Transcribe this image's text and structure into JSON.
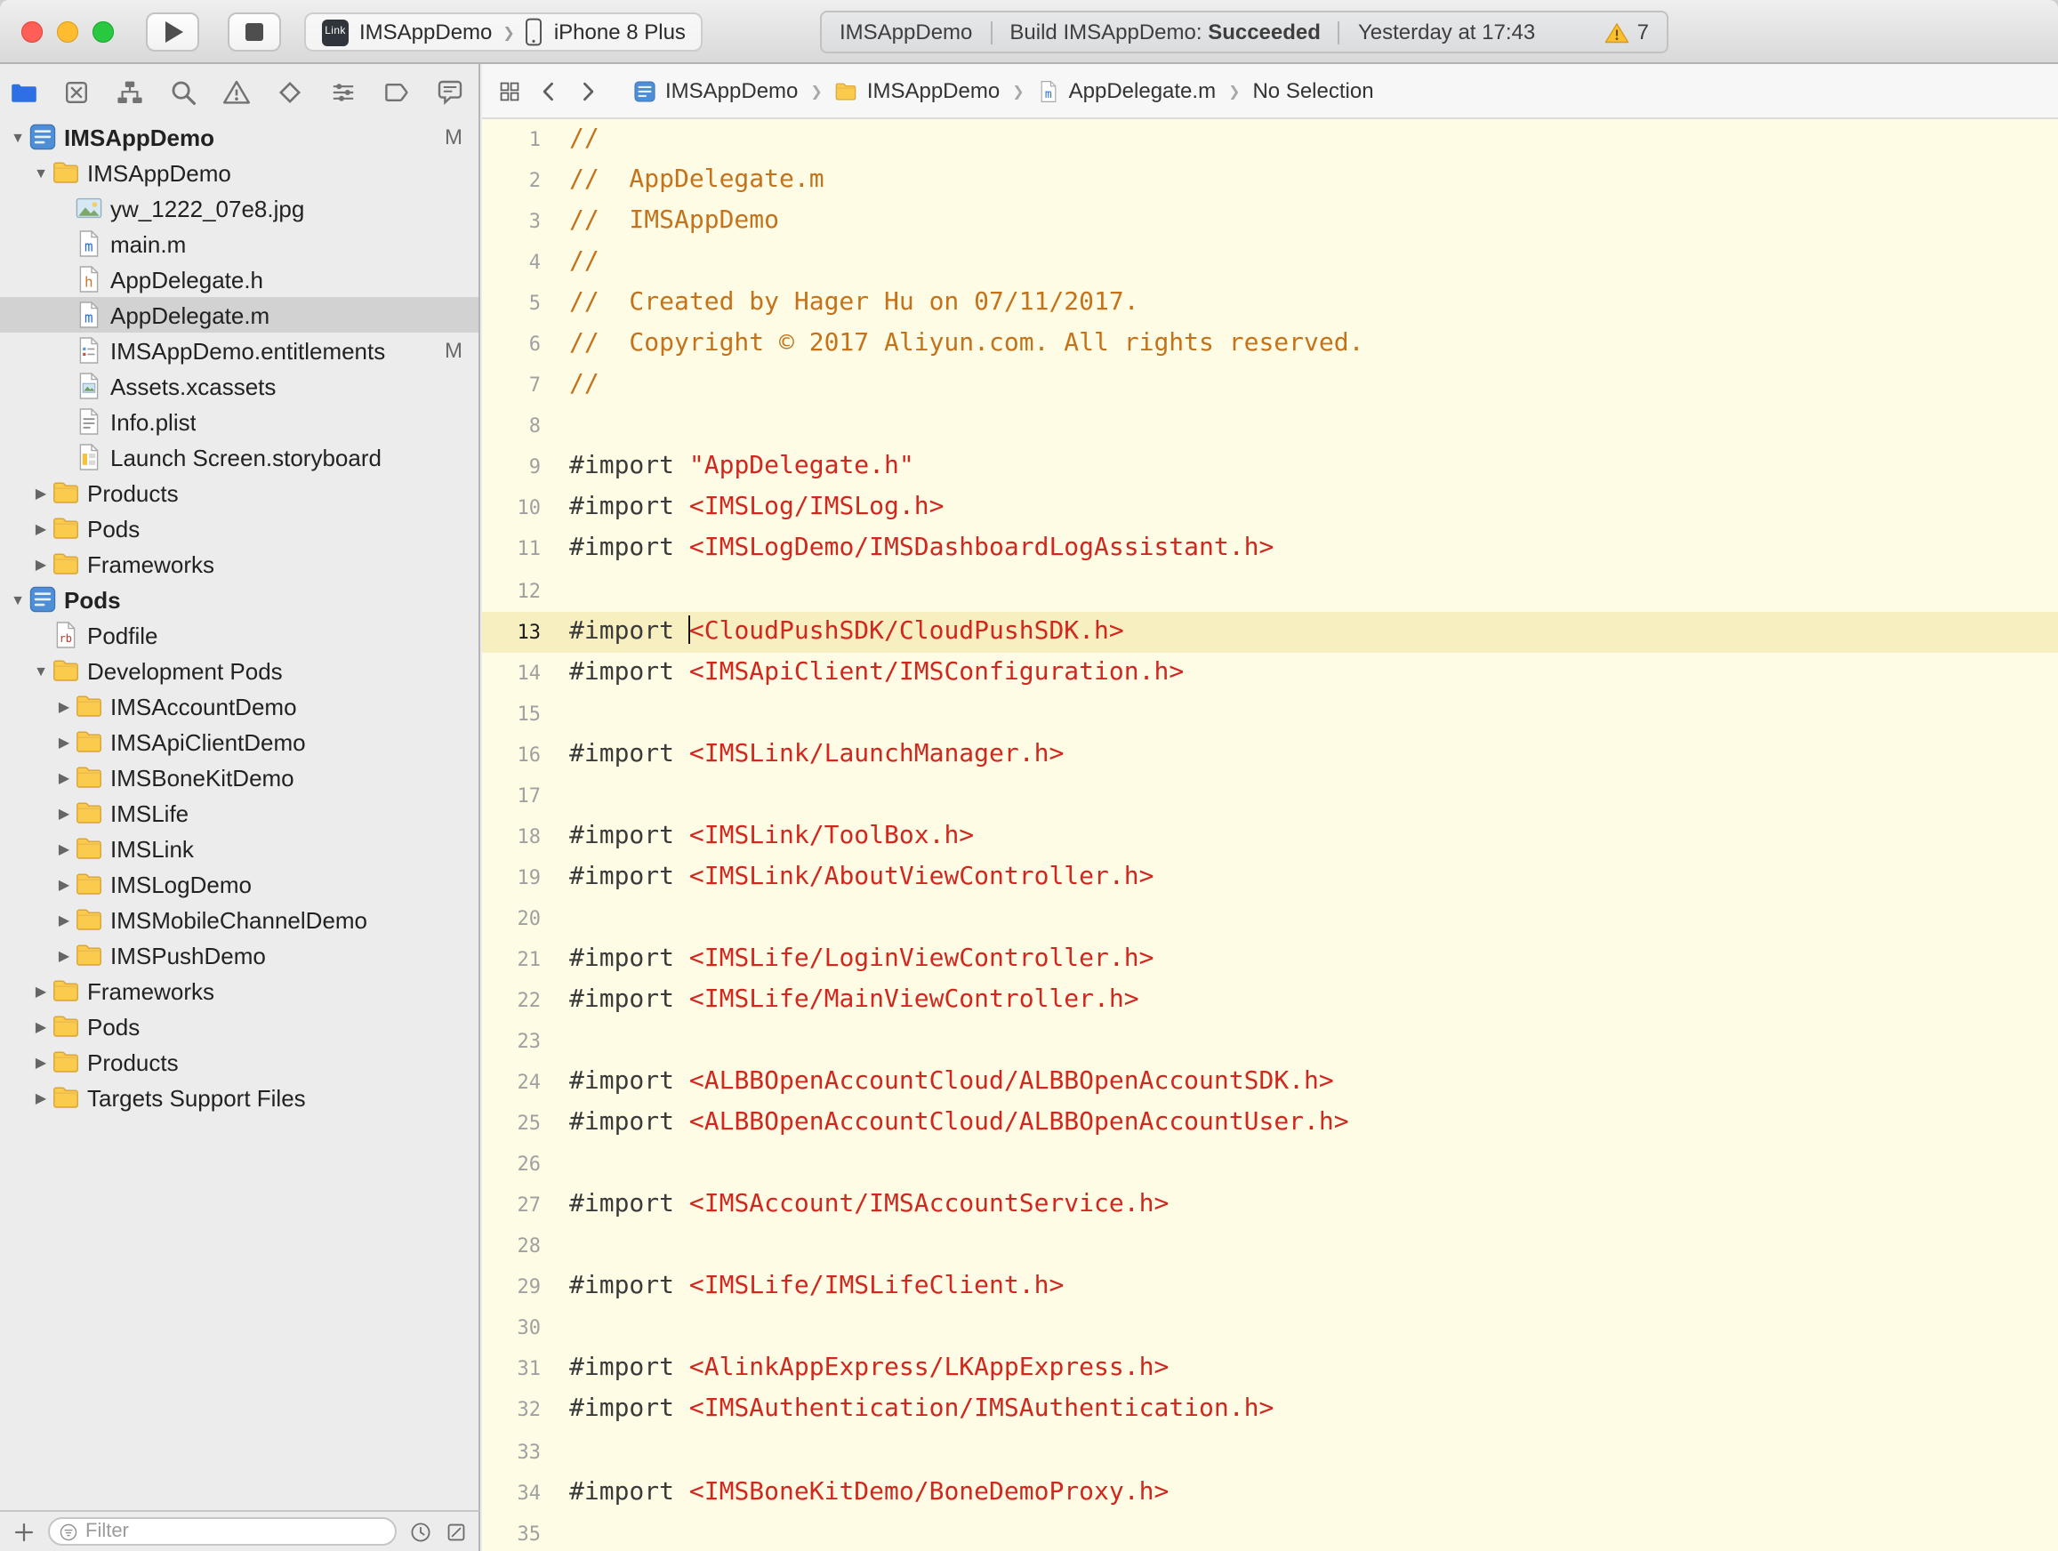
{
  "colors": {
    "editor_bg": "#FFFCE6",
    "line_highlight": "#F8EFC1",
    "comment": "#C4731B",
    "directive": "#3A3A3A",
    "string": "#D0281E",
    "selection": "#D2D2D2",
    "accent": "#2E6FE5"
  },
  "toolbar": {
    "scheme": {
      "app_badge": "Link",
      "scheme_name": "IMSAppDemo",
      "device_name": "iPhone 8 Plus"
    },
    "status": {
      "project": "IMSAppDemo",
      "build_prefix": "Build IMSAppDemo:",
      "build_result": "Succeeded",
      "time_text": "Yesterday at 17:43",
      "warning_count": "7"
    }
  },
  "navigator_bar": {
    "icons": [
      {
        "name": "project-navigator",
        "icon": "nav-project",
        "selected": true
      },
      {
        "name": "source-control-navigator",
        "icon": "nav-source-control",
        "selected": false
      },
      {
        "name": "symbol-navigator",
        "icon": "nav-symbol",
        "selected": false
      },
      {
        "name": "find-navigator",
        "icon": "nav-find",
        "selected": false
      },
      {
        "name": "issue-navigator",
        "icon": "nav-issue",
        "selected": false
      },
      {
        "name": "test-navigator",
        "icon": "nav-test",
        "selected": false
      },
      {
        "name": "debug-navigator",
        "icon": "nav-debug",
        "selected": false
      },
      {
        "name": "breakpoint-navigator",
        "icon": "nav-breakpoint",
        "selected": false
      },
      {
        "name": "report-navigator",
        "icon": "nav-report",
        "selected": false
      }
    ]
  },
  "jump_bar": {
    "crumbs": [
      {
        "label": "IMSAppDemo",
        "icon": "project"
      },
      {
        "label": "IMSAppDemo",
        "icon": "folder"
      },
      {
        "label": "AppDelegate.m",
        "icon": "file-m"
      },
      {
        "label": "No Selection",
        "icon": null
      }
    ]
  },
  "sidebar": {
    "items": [
      {
        "label": "IMSAppDemo",
        "icon": "project",
        "level": 0,
        "disclosure": "open",
        "badge": "M",
        "selected": false
      },
      {
        "label": "IMSAppDemo",
        "icon": "folder",
        "level": 1,
        "disclosure": "open",
        "badge": null,
        "selected": false
      },
      {
        "label": "yw_1222_07e8.jpg",
        "icon": "image",
        "level": 2,
        "disclosure": null,
        "badge": null,
        "selected": false
      },
      {
        "label": "main.m",
        "icon": "file-m",
        "level": 2,
        "disclosure": null,
        "badge": null,
        "selected": false
      },
      {
        "label": "AppDelegate.h",
        "icon": "file-h",
        "level": 2,
        "disclosure": null,
        "badge": null,
        "selected": false
      },
      {
        "label": "AppDelegate.m",
        "icon": "file-m",
        "level": 2,
        "disclosure": null,
        "badge": null,
        "selected": true
      },
      {
        "label": "IMSAppDemo.entitlements",
        "icon": "entitlements",
        "level": 2,
        "disclosure": null,
        "badge": "M",
        "selected": false
      },
      {
        "label": "Assets.xcassets",
        "icon": "xcassets",
        "level": 2,
        "disclosure": null,
        "badge": null,
        "selected": false
      },
      {
        "label": "Info.plist",
        "icon": "plist",
        "level": 2,
        "disclosure": null,
        "badge": null,
        "selected": false
      },
      {
        "label": "Launch Screen.storyboard",
        "icon": "storyboard",
        "level": 2,
        "disclosure": null,
        "badge": null,
        "selected": false
      },
      {
        "label": "Products",
        "icon": "folder",
        "level": 1,
        "disclosure": "closed",
        "badge": null,
        "selected": false
      },
      {
        "label": "Pods",
        "icon": "folder",
        "level": 1,
        "disclosure": "closed",
        "badge": null,
        "selected": false
      },
      {
        "label": "Frameworks",
        "icon": "folder",
        "level": 1,
        "disclosure": "closed",
        "badge": null,
        "selected": false
      },
      {
        "label": "Pods",
        "icon": "project",
        "level": 0,
        "disclosure": "open",
        "badge": null,
        "selected": false
      },
      {
        "label": "Podfile",
        "icon": "podfile",
        "level": 1,
        "disclosure": null,
        "badge": null,
        "selected": false
      },
      {
        "label": "Development Pods",
        "icon": "folder",
        "level": 1,
        "disclosure": "open",
        "badge": null,
        "selected": false
      },
      {
        "label": "IMSAccountDemo",
        "icon": "folder",
        "level": 2,
        "disclosure": "closed",
        "badge": null,
        "selected": false
      },
      {
        "label": "IMSApiClientDemo",
        "icon": "folder",
        "level": 2,
        "disclosure": "closed",
        "badge": null,
        "selected": false
      },
      {
        "label": "IMSBoneKitDemo",
        "icon": "folder",
        "level": 2,
        "disclosure": "closed",
        "badge": null,
        "selected": false
      },
      {
        "label": "IMSLife",
        "icon": "folder",
        "level": 2,
        "disclosure": "closed",
        "badge": null,
        "selected": false
      },
      {
        "label": "IMSLink",
        "icon": "folder",
        "level": 2,
        "disclosure": "closed",
        "badge": null,
        "selected": false
      },
      {
        "label": "IMSLogDemo",
        "icon": "folder",
        "level": 2,
        "disclosure": "closed",
        "badge": null,
        "selected": false
      },
      {
        "label": "IMSMobileChannelDemo",
        "icon": "folder",
        "level": 2,
        "disclosure": "closed",
        "badge": null,
        "selected": false
      },
      {
        "label": "IMSPushDemo",
        "icon": "folder",
        "level": 2,
        "disclosure": "closed",
        "badge": null,
        "selected": false
      },
      {
        "label": "Frameworks",
        "icon": "folder",
        "level": 1,
        "disclosure": "closed",
        "badge": null,
        "selected": false
      },
      {
        "label": "Pods",
        "icon": "folder",
        "level": 1,
        "disclosure": "closed",
        "badge": null,
        "selected": false
      },
      {
        "label": "Products",
        "icon": "folder",
        "level": 1,
        "disclosure": "closed",
        "badge": null,
        "selected": false
      },
      {
        "label": "Targets Support Files",
        "icon": "folder",
        "level": 1,
        "disclosure": "closed",
        "badge": null,
        "selected": false
      }
    ],
    "filter_bar": {
      "placeholder": "Filter"
    }
  },
  "editor": {
    "current_line": 13,
    "lines": [
      {
        "n": 1,
        "t": [
          [
            "c",
            "//"
          ]
        ]
      },
      {
        "n": 2,
        "t": [
          [
            "c",
            "//  AppDelegate.m"
          ]
        ]
      },
      {
        "n": 3,
        "t": [
          [
            "c",
            "//  IMSAppDemo"
          ]
        ]
      },
      {
        "n": 4,
        "t": [
          [
            "c",
            "//"
          ]
        ]
      },
      {
        "n": 5,
        "t": [
          [
            "c",
            "//  Created by Hager Hu on 07/11/2017."
          ]
        ]
      },
      {
        "n": 6,
        "t": [
          [
            "c",
            "//  Copyright © 2017 Aliyun.com. All rights reserved."
          ]
        ]
      },
      {
        "n": 7,
        "t": [
          [
            "c",
            "//"
          ]
        ]
      },
      {
        "n": 8,
        "t": []
      },
      {
        "n": 9,
        "t": [
          [
            "p",
            "#import "
          ],
          [
            "s",
            "\"AppDelegate.h\""
          ]
        ]
      },
      {
        "n": 10,
        "t": [
          [
            "p",
            "#import "
          ],
          [
            "s",
            "<IMSLog/IMSLog.h>"
          ]
        ]
      },
      {
        "n": 11,
        "t": [
          [
            "p",
            "#import "
          ],
          [
            "s",
            "<IMSLogDemo/IMSDashboardLogAssistant.h>"
          ]
        ]
      },
      {
        "n": 12,
        "t": []
      },
      {
        "n": 13,
        "t": [
          [
            "p",
            "#import "
          ],
          [
            "caret",
            ""
          ],
          [
            "s",
            "<CloudPushSDK/CloudPushSDK.h>"
          ]
        ]
      },
      {
        "n": 14,
        "t": [
          [
            "p",
            "#import "
          ],
          [
            "s",
            "<IMSApiClient/IMSConfiguration.h>"
          ]
        ]
      },
      {
        "n": 15,
        "t": []
      },
      {
        "n": 16,
        "t": [
          [
            "p",
            "#import "
          ],
          [
            "s",
            "<IMSLink/LaunchManager.h>"
          ]
        ]
      },
      {
        "n": 17,
        "t": []
      },
      {
        "n": 18,
        "t": [
          [
            "p",
            "#import "
          ],
          [
            "s",
            "<IMSLink/ToolBox.h>"
          ]
        ]
      },
      {
        "n": 19,
        "t": [
          [
            "p",
            "#import "
          ],
          [
            "s",
            "<IMSLink/AboutViewController.h>"
          ]
        ]
      },
      {
        "n": 20,
        "t": []
      },
      {
        "n": 21,
        "t": [
          [
            "p",
            "#import "
          ],
          [
            "s",
            "<IMSLife/LoginViewController.h>"
          ]
        ]
      },
      {
        "n": 22,
        "t": [
          [
            "p",
            "#import "
          ],
          [
            "s",
            "<IMSLife/MainViewController.h>"
          ]
        ]
      },
      {
        "n": 23,
        "t": []
      },
      {
        "n": 24,
        "t": [
          [
            "p",
            "#import "
          ],
          [
            "s",
            "<ALBBOpenAccountCloud/ALBBOpenAccountSDK.h>"
          ]
        ]
      },
      {
        "n": 25,
        "t": [
          [
            "p",
            "#import "
          ],
          [
            "s",
            "<ALBBOpenAccountCloud/ALBBOpenAccountUser.h>"
          ]
        ]
      },
      {
        "n": 26,
        "t": []
      },
      {
        "n": 27,
        "t": [
          [
            "p",
            "#import "
          ],
          [
            "s",
            "<IMSAccount/IMSAccountService.h>"
          ]
        ]
      },
      {
        "n": 28,
        "t": []
      },
      {
        "n": 29,
        "t": [
          [
            "p",
            "#import "
          ],
          [
            "s",
            "<IMSLife/IMSLifeClient.h>"
          ]
        ]
      },
      {
        "n": 30,
        "t": []
      },
      {
        "n": 31,
        "t": [
          [
            "p",
            "#import "
          ],
          [
            "s",
            "<AlinkAppExpress/LKAppExpress.h>"
          ]
        ]
      },
      {
        "n": 32,
        "t": [
          [
            "p",
            "#import "
          ],
          [
            "s",
            "<IMSAuthentication/IMSAuthentication.h>"
          ]
        ]
      },
      {
        "n": 33,
        "t": []
      },
      {
        "n": 34,
        "t": [
          [
            "p",
            "#import "
          ],
          [
            "s",
            "<IMSBoneKitDemo/BoneDemoProxy.h>"
          ]
        ]
      },
      {
        "n": 35,
        "t": []
      }
    ]
  }
}
